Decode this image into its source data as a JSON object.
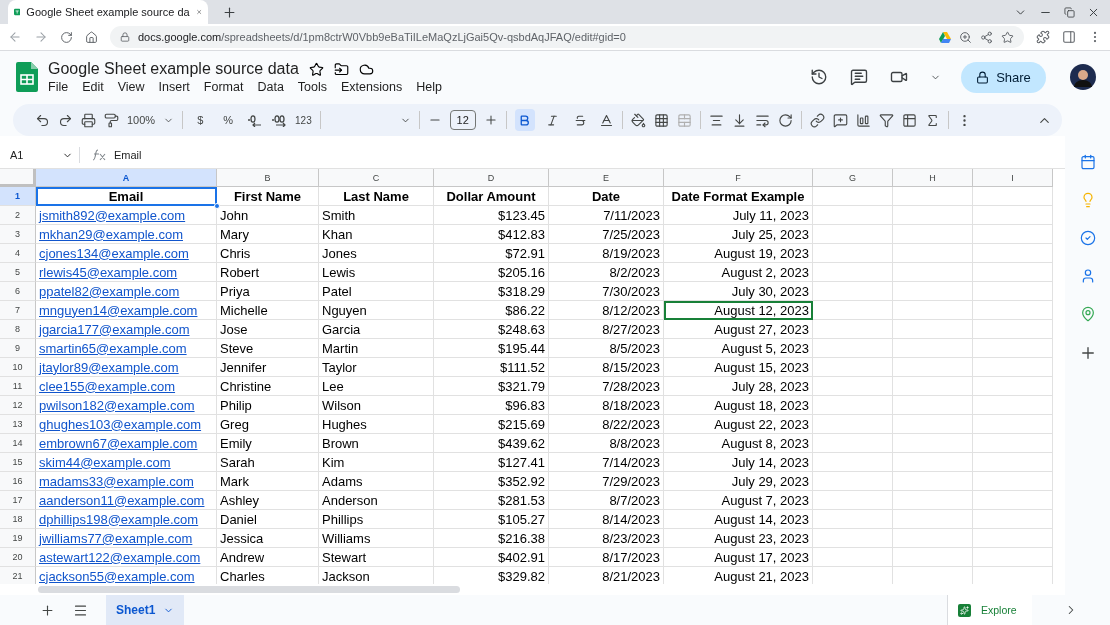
{
  "browser": {
    "tab_title": "Google Sheet example source da",
    "url_host": "docs.google.com",
    "url_path": "/spreadsheets/d/1pm8ctrW0Vbb9eBaTiILeMaQzLjGai5Qv-qsbdAqJFAQ/edit#gid=0"
  },
  "document": {
    "title": "Google Sheet example source data",
    "menu": [
      "File",
      "Edit",
      "View",
      "Insert",
      "Format",
      "Data",
      "Tools",
      "Extensions",
      "Help"
    ],
    "share_label": "Share"
  },
  "toolbar": {
    "zoom": "100%",
    "currency": "$",
    "percent": "%",
    "number_format": "123",
    "font_size": "12",
    "bold": true,
    "italic": false,
    "strikethrough": false
  },
  "formula_bar": {
    "cell_ref": "A1",
    "content": "Email"
  },
  "columns": [
    {
      "letter": "A",
      "selected": true,
      "kind": "link"
    },
    {
      "letter": "B",
      "selected": false,
      "kind": "text"
    },
    {
      "letter": "C",
      "selected": false,
      "kind": "text"
    },
    {
      "letter": "D",
      "selected": false,
      "kind": "number"
    },
    {
      "letter": "E",
      "selected": false,
      "kind": "number"
    },
    {
      "letter": "F",
      "selected": false,
      "kind": "number"
    },
    {
      "letter": "G",
      "selected": false,
      "kind": "text"
    },
    {
      "letter": "H",
      "selected": false,
      "kind": "text"
    },
    {
      "letter": "I",
      "selected": false,
      "kind": "text"
    }
  ],
  "rows": [
    {
      "number": "1",
      "selected": true,
      "kind": "header",
      "cells": [
        {
          "text": "Email",
          "selected": true
        },
        {
          "text": "First Name"
        },
        {
          "text": "Last Name"
        },
        {
          "text": "Dollar Amount"
        },
        {
          "text": "Date"
        },
        {
          "text": "Date Format Example"
        }
      ]
    },
    {
      "number": "2",
      "selected": false,
      "kind": "data",
      "cells": [
        {
          "text": "jsmith892@example.com"
        },
        {
          "text": "John"
        },
        {
          "text": "Smith"
        },
        {
          "text": "$123.45"
        },
        {
          "text": "7/11/2023"
        },
        {
          "text": "July 11, 2023"
        }
      ]
    },
    {
      "number": "3",
      "selected": false,
      "kind": "data",
      "cells": [
        {
          "text": "mkhan29@example.com"
        },
        {
          "text": "Mary"
        },
        {
          "text": "Khan"
        },
        {
          "text": "$412.83"
        },
        {
          "text": "7/25/2023"
        },
        {
          "text": "July 25, 2023"
        }
      ]
    },
    {
      "number": "4",
      "selected": false,
      "kind": "data",
      "cells": [
        {
          "text": "cjones134@example.com"
        },
        {
          "text": "Chris"
        },
        {
          "text": "Jones"
        },
        {
          "text": "$72.91"
        },
        {
          "text": "8/19/2023"
        },
        {
          "text": "August 19, 2023"
        }
      ]
    },
    {
      "number": "5",
      "selected": false,
      "kind": "data",
      "cells": [
        {
          "text": "rlewis45@example.com"
        },
        {
          "text": "Robert"
        },
        {
          "text": "Lewis"
        },
        {
          "text": "$205.16"
        },
        {
          "text": "8/2/2023"
        },
        {
          "text": "August 2, 2023"
        }
      ]
    },
    {
      "number": "6",
      "selected": false,
      "kind": "data",
      "cells": [
        {
          "text": "ppatel82@example.com"
        },
        {
          "text": "Priya"
        },
        {
          "text": "Patel"
        },
        {
          "text": "$318.29"
        },
        {
          "text": "7/30/2023"
        },
        {
          "text": "July 30, 2023"
        }
      ]
    },
    {
      "number": "7",
      "selected": false,
      "kind": "data",
      "cells": [
        {
          "text": "mnguyen14@example.com"
        },
        {
          "text": "Michelle"
        },
        {
          "text": "Nguyen"
        },
        {
          "text": "$86.22"
        },
        {
          "text": "8/12/2023"
        },
        {
          "text": "August 12, 2023",
          "collaborator_cursor": true
        }
      ]
    },
    {
      "number": "8",
      "selected": false,
      "kind": "data",
      "cells": [
        {
          "text": "jgarcia177@example.com"
        },
        {
          "text": "Jose"
        },
        {
          "text": "Garcia"
        },
        {
          "text": "$248.63"
        },
        {
          "text": "8/27/2023"
        },
        {
          "text": "August 27, 2023"
        }
      ]
    },
    {
      "number": "9",
      "selected": false,
      "kind": "data",
      "cells": [
        {
          "text": "smartin65@example.com"
        },
        {
          "text": "Steve"
        },
        {
          "text": "Martin"
        },
        {
          "text": "$195.44"
        },
        {
          "text": "8/5/2023"
        },
        {
          "text": "August 5, 2023"
        }
      ]
    },
    {
      "number": "10",
      "selected": false,
      "kind": "data",
      "cells": [
        {
          "text": "jtaylor89@example.com"
        },
        {
          "text": "Jennifer"
        },
        {
          "text": "Taylor"
        },
        {
          "text": "$111.52"
        },
        {
          "text": "8/15/2023"
        },
        {
          "text": "August 15, 2023"
        }
      ]
    },
    {
      "number": "11",
      "selected": false,
      "kind": "data",
      "cells": [
        {
          "text": "clee155@example.com"
        },
        {
          "text": "Christine"
        },
        {
          "text": "Lee"
        },
        {
          "text": "$321.79"
        },
        {
          "text": "7/28/2023"
        },
        {
          "text": "July 28, 2023"
        }
      ]
    },
    {
      "number": "12",
      "selected": false,
      "kind": "data",
      "cells": [
        {
          "text": "pwilson182@example.com"
        },
        {
          "text": "Philip"
        },
        {
          "text": "Wilson"
        },
        {
          "text": "$96.83"
        },
        {
          "text": "8/18/2023"
        },
        {
          "text": "August 18, 2023"
        }
      ]
    },
    {
      "number": "13",
      "selected": false,
      "kind": "data",
      "cells": [
        {
          "text": "ghughes103@example.com"
        },
        {
          "text": "Greg"
        },
        {
          "text": "Hughes"
        },
        {
          "text": "$215.69"
        },
        {
          "text": "8/22/2023"
        },
        {
          "text": "August 22, 2023"
        }
      ]
    },
    {
      "number": "14",
      "selected": false,
      "kind": "data",
      "cells": [
        {
          "text": "embrown67@example.com"
        },
        {
          "text": "Emily"
        },
        {
          "text": "Brown"
        },
        {
          "text": "$439.62"
        },
        {
          "text": "8/8/2023"
        },
        {
          "text": "August 8, 2023"
        }
      ]
    },
    {
      "number": "15",
      "selected": false,
      "kind": "data",
      "cells": [
        {
          "text": "skim44@example.com"
        },
        {
          "text": "Sarah"
        },
        {
          "text": "Kim"
        },
        {
          "text": "$127.41"
        },
        {
          "text": "7/14/2023"
        },
        {
          "text": "July 14, 2023"
        }
      ]
    },
    {
      "number": "16",
      "selected": false,
      "kind": "data",
      "cells": [
        {
          "text": "madams33@example.com"
        },
        {
          "text": "Mark"
        },
        {
          "text": "Adams"
        },
        {
          "text": "$352.92"
        },
        {
          "text": "7/29/2023"
        },
        {
          "text": "July 29, 2023"
        }
      ]
    },
    {
      "number": "17",
      "selected": false,
      "kind": "data",
      "cells": [
        {
          "text": "aanderson11@example.com"
        },
        {
          "text": "Ashley"
        },
        {
          "text": "Anderson"
        },
        {
          "text": "$281.53"
        },
        {
          "text": "8/7/2023"
        },
        {
          "text": "August 7, 2023"
        }
      ]
    },
    {
      "number": "18",
      "selected": false,
      "kind": "data",
      "cells": [
        {
          "text": "dphillips198@example.com"
        },
        {
          "text": "Daniel"
        },
        {
          "text": "Phillips"
        },
        {
          "text": "$105.27"
        },
        {
          "text": "8/14/2023"
        },
        {
          "text": "August 14, 2023"
        }
      ]
    },
    {
      "number": "19",
      "selected": false,
      "kind": "data",
      "cells": [
        {
          "text": "jwilliams77@example.com"
        },
        {
          "text": "Jessica"
        },
        {
          "text": "Williams"
        },
        {
          "text": "$216.38"
        },
        {
          "text": "8/23/2023"
        },
        {
          "text": "August 23, 2023"
        }
      ]
    },
    {
      "number": "20",
      "selected": false,
      "kind": "data",
      "cells": [
        {
          "text": "astewart122@example.com"
        },
        {
          "text": "Andrew"
        },
        {
          "text": "Stewart"
        },
        {
          "text": "$402.91"
        },
        {
          "text": "8/17/2023"
        },
        {
          "text": "August 17, 2023"
        }
      ]
    },
    {
      "number": "21",
      "selected": false,
      "kind": "data",
      "cells": [
        {
          "text": "cjackson55@example.com"
        },
        {
          "text": "Charles"
        },
        {
          "text": "Jackson"
        },
        {
          "text": "$329.82"
        },
        {
          "text": "8/21/2023"
        },
        {
          "text": "August 21, 2023"
        }
      ]
    }
  ],
  "sheet_tabs": [
    {
      "label": "Sheet1",
      "selected": true
    }
  ],
  "explore_label": "Explore"
}
